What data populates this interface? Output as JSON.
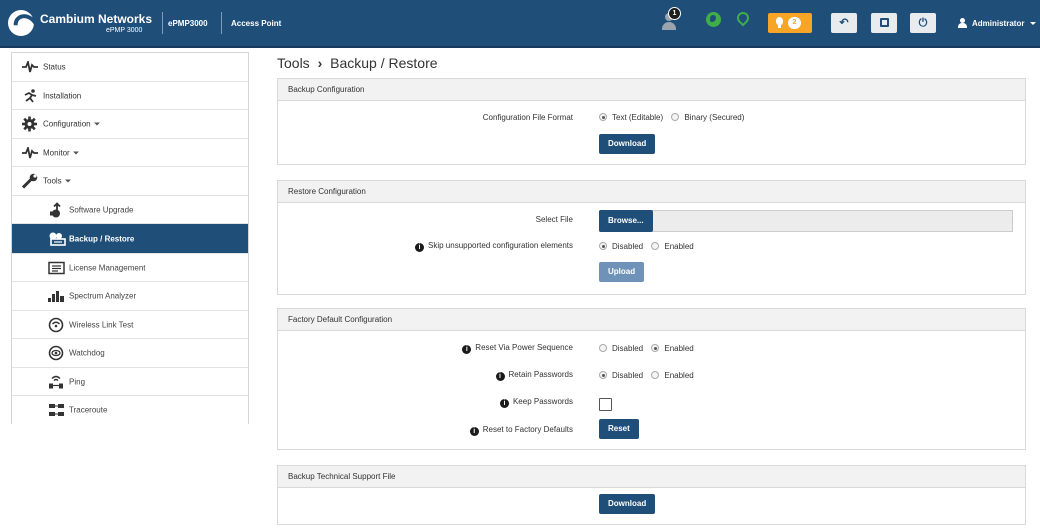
{
  "header": {
    "brand": "Cambium Networks",
    "model": "ePMP 3000",
    "device_name": "ePMP3000",
    "mode": "Access Point",
    "user_badge": "1",
    "alert_count": "2",
    "user": "Administrator",
    "accent": "#1f4e79",
    "alert_color": "#f7a427",
    "status_color": "#3fae49"
  },
  "sidebar": {
    "items": [
      {
        "label": "Status",
        "icon": "pulse-icon"
      },
      {
        "label": "Installation",
        "icon": "runner-icon"
      },
      {
        "label": "Configuration",
        "icon": "gear-icon"
      },
      {
        "label": "Monitor",
        "icon": "pulse-icon"
      },
      {
        "label": "Tools",
        "icon": "wrench-icon"
      },
      {
        "label": "Software Upgrade",
        "icon": "upgrade-icon"
      },
      {
        "label": "Backup / Restore",
        "icon": "backup-icon"
      },
      {
        "label": "License Management",
        "icon": "license-icon"
      },
      {
        "label": "Spectrum Analyzer",
        "icon": "spectrum-icon"
      },
      {
        "label": "Wireless Link Test",
        "icon": "link-test-icon"
      },
      {
        "label": "Watchdog",
        "icon": "eye-icon"
      },
      {
        "label": "Ping",
        "icon": "ping-icon"
      },
      {
        "label": "Traceroute",
        "icon": "traceroute-icon"
      }
    ]
  },
  "page": {
    "title": "Tools",
    "separator": "›",
    "subtitle": "Backup / Restore"
  },
  "backup": {
    "heading": "Backup Configuration",
    "format_label": "Configuration File Format",
    "option_text": "Text (Editable)",
    "option_binary": "Binary (Secured)",
    "selected": "Text (Editable)",
    "download": "Download"
  },
  "restore": {
    "heading": "Restore Configuration",
    "select_file_label": "Select File",
    "browse": "Browse...",
    "skip_label": "Skip unsupported configuration elements",
    "opt_disabled": "Disabled",
    "opt_enabled": "Enabled",
    "selected": "Disabled",
    "upload": "Upload"
  },
  "factory": {
    "heading": "Factory Default Configuration",
    "power_seq_label": "Reset Via Power Sequence",
    "power_seq_selected": "Enabled",
    "retain_label": "Retain Passwords",
    "retain_selected": "Disabled",
    "keep_label": "Keep Passwords",
    "keep_checked": false,
    "reset_label": "Reset to Factory Defaults",
    "reset": "Reset",
    "opt_disabled": "Disabled",
    "opt_enabled": "Enabled"
  },
  "support": {
    "heading": "Backup Technical Support File",
    "download": "Download"
  }
}
